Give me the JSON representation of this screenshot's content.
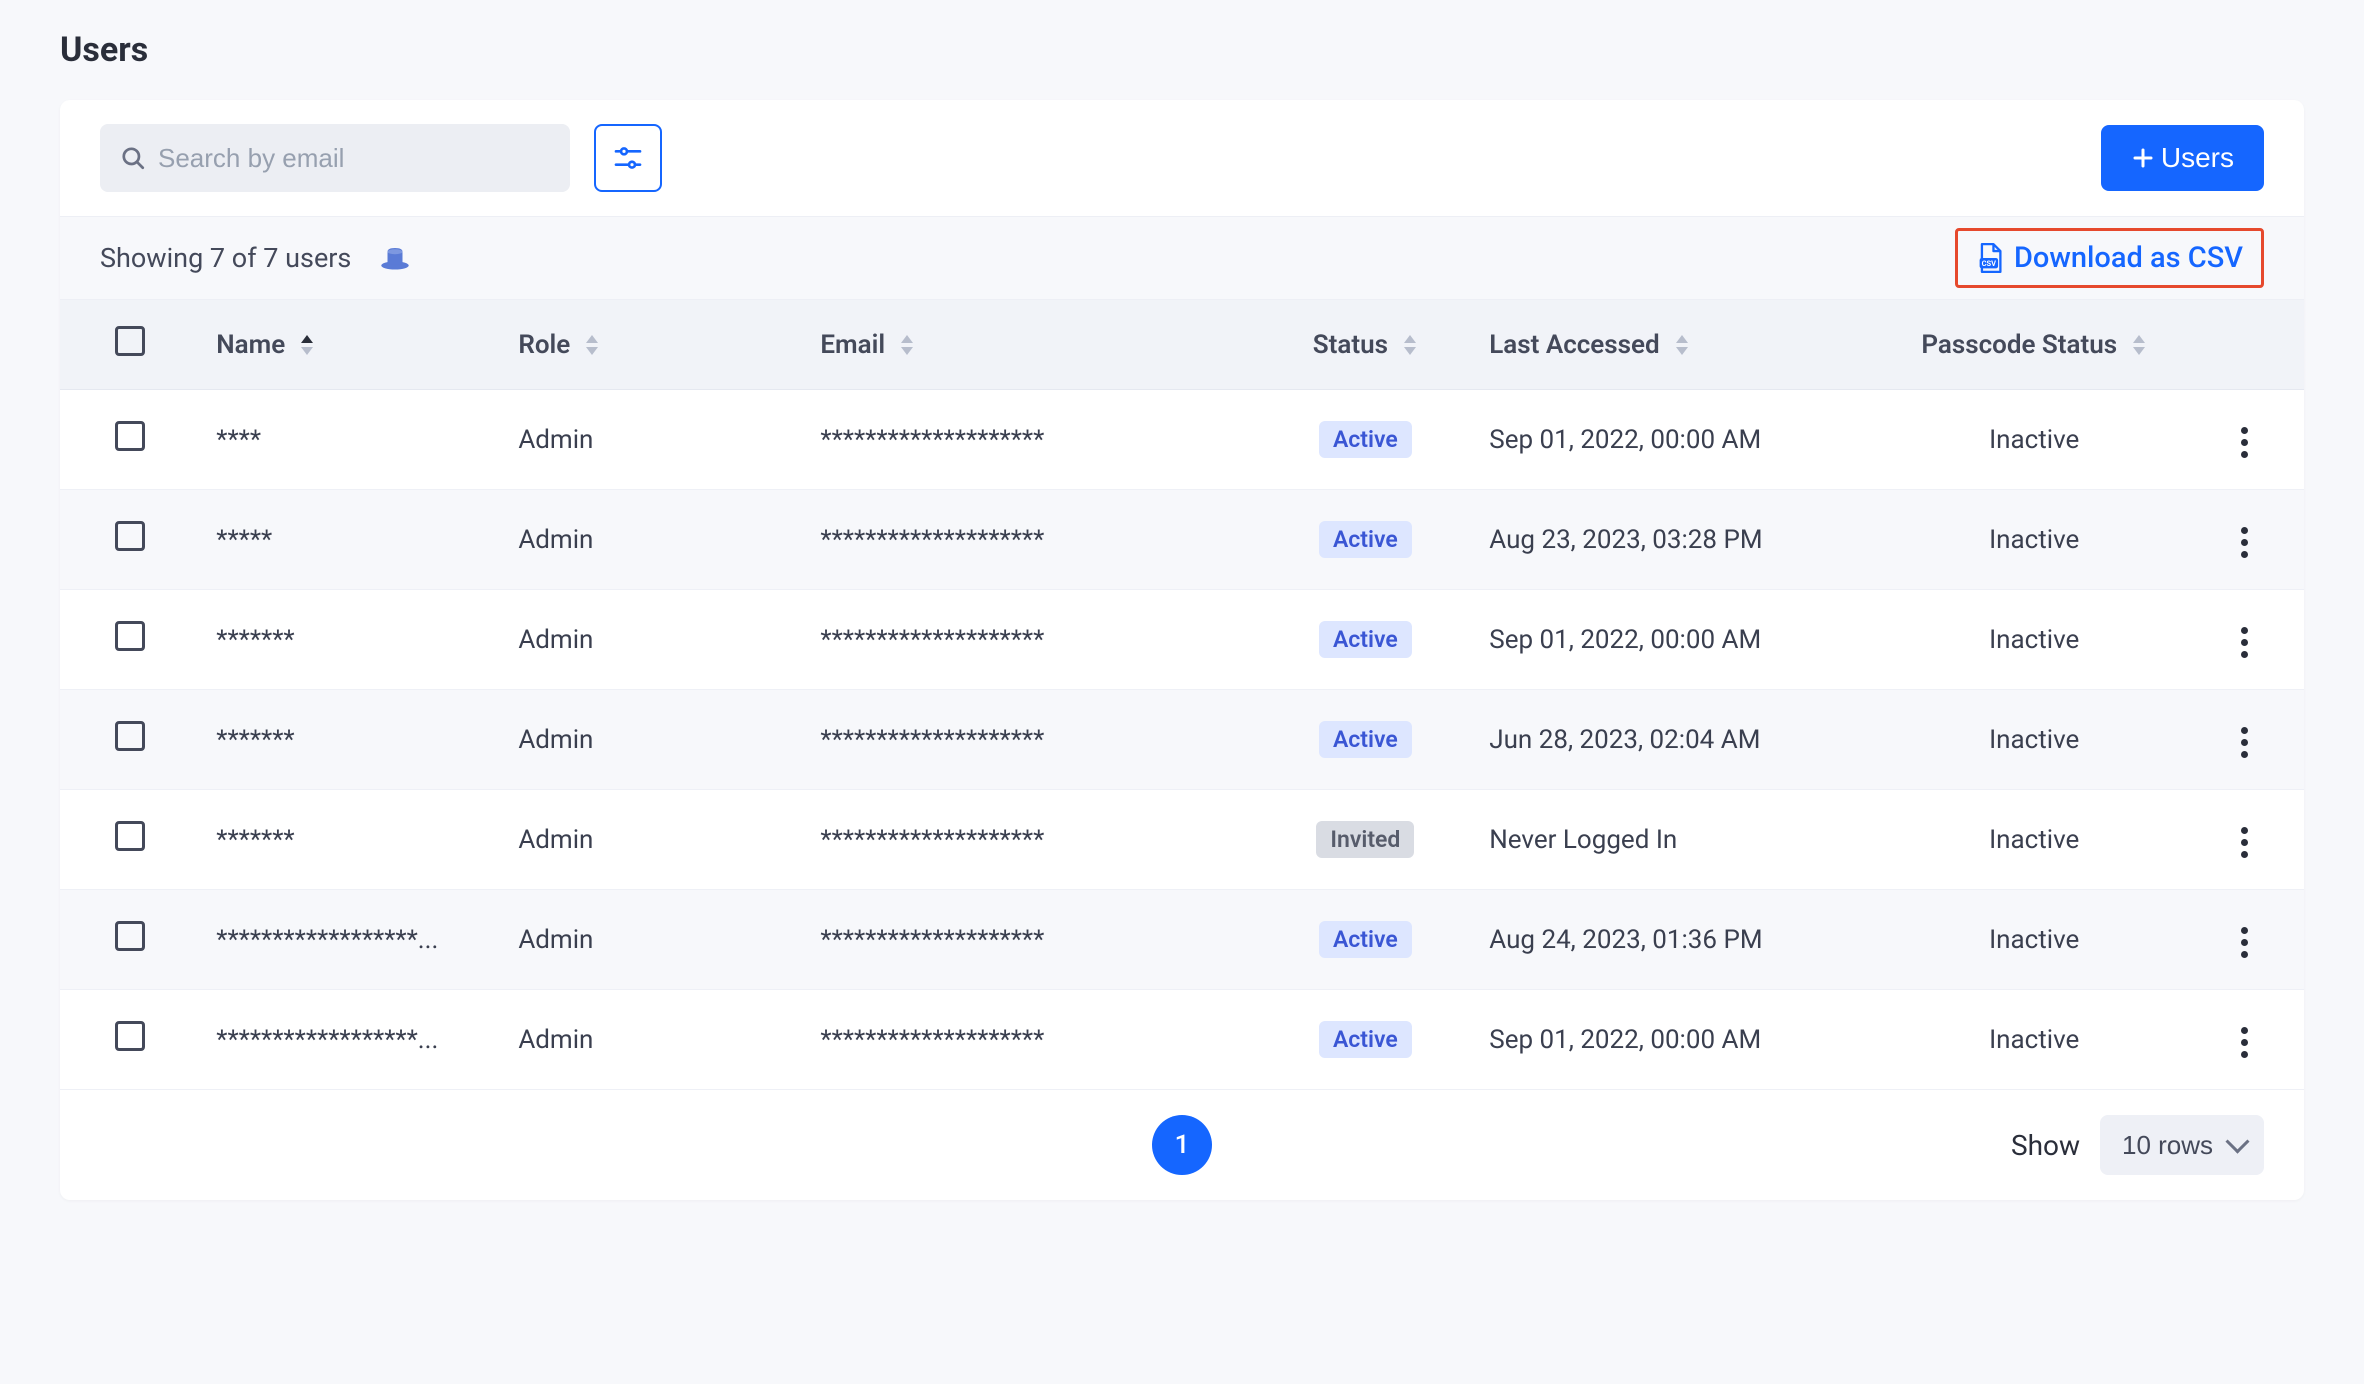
{
  "page_title": "Users",
  "toolbar": {
    "search_placeholder": "Search by email",
    "add_users_label": "Users"
  },
  "meta": {
    "showing_text": "Showing 7 of 7 users",
    "csv_label": "Download as CSV"
  },
  "columns": {
    "name": "Name",
    "role": "Role",
    "email": "Email",
    "status": "Status",
    "last_accessed": "Last Accessed",
    "passcode_status": "Passcode Status"
  },
  "rows": [
    {
      "name": "****",
      "role": "Admin",
      "email": "********************",
      "status": "Active",
      "status_kind": "active",
      "last_accessed": "Sep 01, 2022, 00:00 AM",
      "passcode_status": "Inactive"
    },
    {
      "name": "*****",
      "role": "Admin",
      "email": "********************",
      "status": "Active",
      "status_kind": "active",
      "last_accessed": "Aug 23, 2023, 03:28 PM",
      "passcode_status": "Inactive"
    },
    {
      "name": "*******",
      "role": "Admin",
      "email": "********************",
      "status": "Active",
      "status_kind": "active",
      "last_accessed": "Sep 01, 2022, 00:00 AM",
      "passcode_status": "Inactive"
    },
    {
      "name": "*******",
      "role": "Admin",
      "email": "********************",
      "status": "Active",
      "status_kind": "active",
      "last_accessed": "Jun 28, 2023, 02:04 AM",
      "passcode_status": "Inactive"
    },
    {
      "name": "*******",
      "role": "Admin",
      "email": "********************",
      "status": "Invited",
      "status_kind": "invited",
      "last_accessed": "Never Logged In",
      "passcode_status": "Inactive"
    },
    {
      "name": "******************...",
      "role": "Admin",
      "email": "********************",
      "status": "Active",
      "status_kind": "active",
      "last_accessed": "Aug 24, 2023, 01:36 PM",
      "passcode_status": "Inactive"
    },
    {
      "name": "******************...",
      "role": "Admin",
      "email": "********************",
      "status": "Active",
      "status_kind": "active",
      "last_accessed": "Sep 01, 2022, 00:00 AM",
      "passcode_status": "Inactive"
    }
  ],
  "pagination": {
    "current_page": "1",
    "show_label": "Show",
    "rows_label": "10 rows"
  }
}
